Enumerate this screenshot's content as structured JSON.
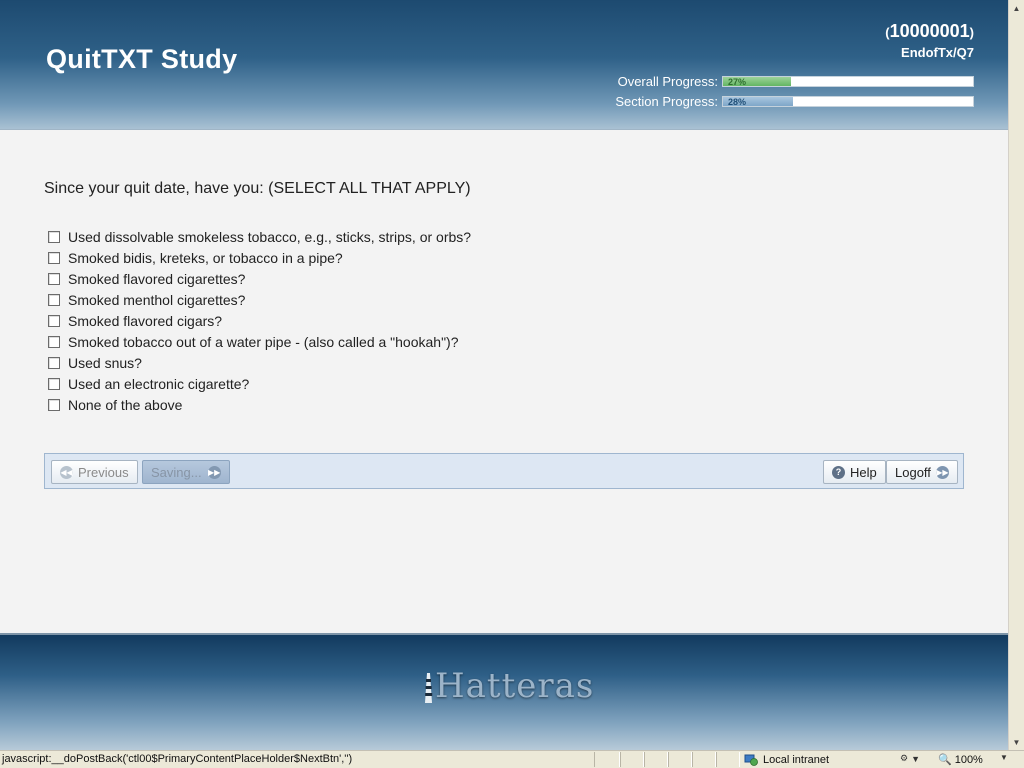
{
  "header": {
    "title": "QuitTXT Study",
    "participant_id": "10000001",
    "participant_open": "(",
    "participant_close": ")",
    "form_code": "EndofTx/Q7",
    "overall_progress": {
      "label": "Overall Progress:",
      "text": "27%",
      "percent": 27
    },
    "section_progress": {
      "label": "Section Progress:",
      "text": "28%",
      "percent": 28
    }
  },
  "main": {
    "question": "Since your quit date, have you: (SELECT ALL THAT APPLY)",
    "options": [
      {
        "label": "Used dissolvable smokeless tobacco, e.g., sticks, strips, or orbs?",
        "checked": false
      },
      {
        "label": "Smoked bidis, kreteks, or tobacco in a pipe?",
        "checked": false
      },
      {
        "label": "Smoked flavored cigarettes?",
        "checked": false
      },
      {
        "label": "Smoked menthol cigarettes?",
        "checked": false
      },
      {
        "label": "Smoked flavored cigars?",
        "checked": false
      },
      {
        "label": "Smoked tobacco out of a water pipe - (also called a \"hookah\")?",
        "checked": false
      },
      {
        "label": "Used snus?",
        "checked": false
      },
      {
        "label": "Used an electronic cigarette?",
        "checked": false
      },
      {
        "label": "None of the above",
        "checked": false
      }
    ]
  },
  "nav": {
    "previous_label": "Previous",
    "next_label": "Saving...",
    "help_label": "Help",
    "logoff_label": "Logoff"
  },
  "footer": {
    "logo_text": "Hatteras"
  },
  "statusbar": {
    "text": "javascript:__doPostBack('ctl00$PrimaryContentPlaceHolder$NextBtn','')",
    "zone": "Local intranet",
    "zoom": "100%"
  },
  "colors": {
    "header_dark": "#1d4a70",
    "overall_fill": "#63b563",
    "section_fill": "#7ea6c8",
    "navbar_bg": "#dde7f3"
  }
}
